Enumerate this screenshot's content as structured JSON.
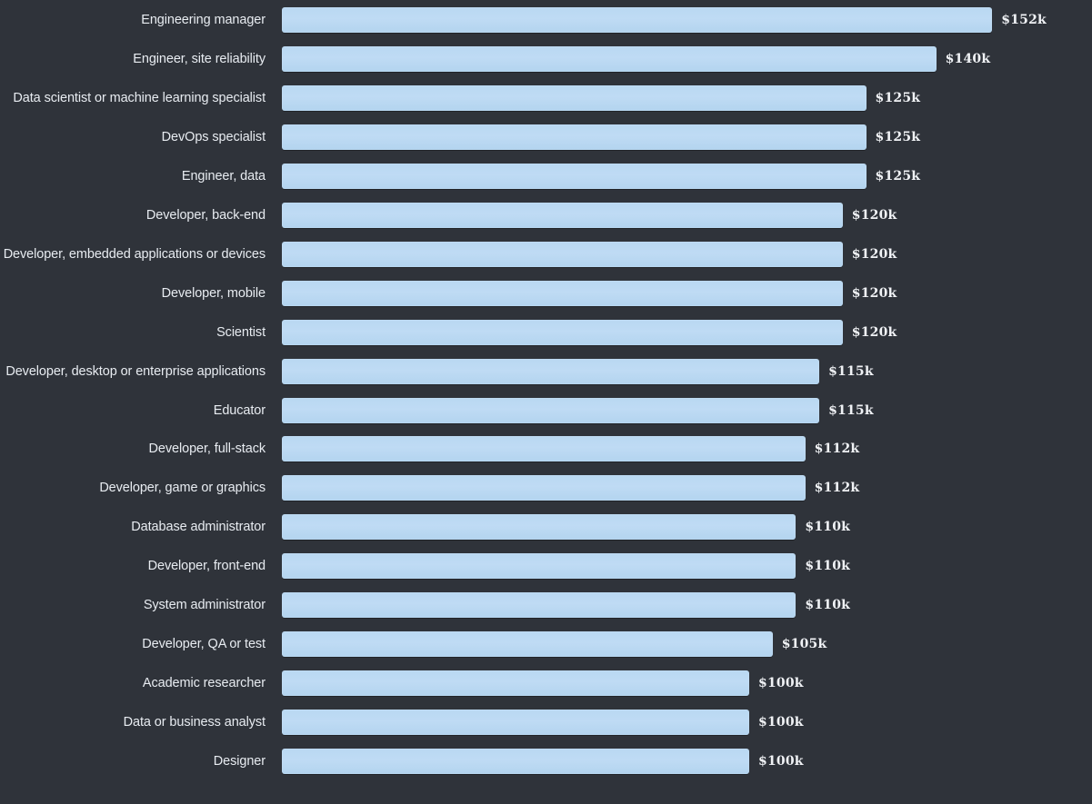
{
  "chart": {
    "background_color": "#2f333a",
    "bar_color": "#bad9f2",
    "label_color": "#e8ecf1",
    "value_color": "#f0f2f5"
  },
  "chart_data": {
    "type": "bar",
    "orientation": "horizontal",
    "title": "",
    "xlabel": "",
    "ylabel": "",
    "xlim": [
      0,
      152
    ],
    "grid": false,
    "legend": null,
    "categories": [
      "Engineering manager",
      "Engineer, site reliability",
      "Data scientist or machine learning specialist",
      "DevOps specialist",
      "Engineer, data",
      "Developer, back-end",
      "Developer, embedded applications or devices",
      "Developer, mobile",
      "Scientist",
      "Developer, desktop or enterprise applications",
      "Educator",
      "Developer, full-stack",
      "Developer, game or graphics",
      "Database administrator",
      "Developer, front-end",
      "System administrator",
      "Developer, QA or test",
      "Academic researcher",
      "Data or business analyst",
      "Designer"
    ],
    "values": [
      152,
      140,
      125,
      125,
      125,
      120,
      120,
      120,
      120,
      115,
      115,
      112,
      112,
      110,
      110,
      110,
      105,
      100,
      100,
      100
    ],
    "value_labels": [
      "$152k",
      "$140k",
      "$125k",
      "$125k",
      "$125k",
      "$120k",
      "$120k",
      "$120k",
      "$120k",
      "$115k",
      "$115k",
      "$112k",
      "$112k",
      "$110k",
      "$110k",
      "$110k",
      "$105k",
      "$100k",
      "$100k",
      "$100k"
    ]
  }
}
